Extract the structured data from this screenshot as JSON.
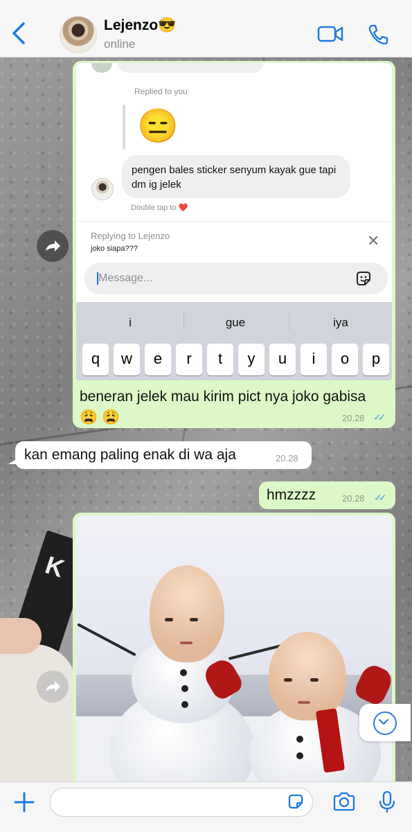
{
  "header": {
    "contact_name": "Lejenzo😎",
    "status": "online",
    "icons": {
      "back": "back-chevron-icon",
      "video": "video-call-icon",
      "call": "phone-call-icon"
    },
    "accent_color": "#1f7ae0"
  },
  "screenshot": {
    "replied_label": "Replied to you",
    "sticker_emoji": "😑",
    "message": "pengen bales sticker senyum kayak gue tapi dm ig jelek",
    "double_tap": "Double tap to ❤️",
    "replying_to": "Replying to Lejenzo",
    "reply_preview": "joko siapa???",
    "input_placeholder": "Message...",
    "suggestions": [
      "i",
      "gue",
      "iya"
    ],
    "keys": [
      "q",
      "w",
      "e",
      "r",
      "t",
      "y",
      "u",
      "i",
      "o",
      "p"
    ]
  },
  "messages": [
    {
      "side": "out",
      "text": "beneran jelek mau kirim pict nya joko gabisa😩 😩",
      "time": "20.28",
      "read": true
    },
    {
      "side": "in",
      "text": "kan emang paling enak di wa aja",
      "time": "20.28"
    },
    {
      "side": "out",
      "text": "hmzzzz",
      "time": "20.28",
      "read": true
    }
  ],
  "photo_message": {
    "description_icon": "snowman-photo",
    "side": "out"
  },
  "book_cover_text": "K",
  "ticks": "✓✓",
  "bottom_bar": {
    "icons": [
      "plus-icon",
      "sticker-icon",
      "camera-icon",
      "microphone-icon"
    ]
  },
  "colors": {
    "outgoing_bubble": "#dcf8c6",
    "incoming_bubble": "#ffffff",
    "read_ticks": "#4fa3e8"
  }
}
